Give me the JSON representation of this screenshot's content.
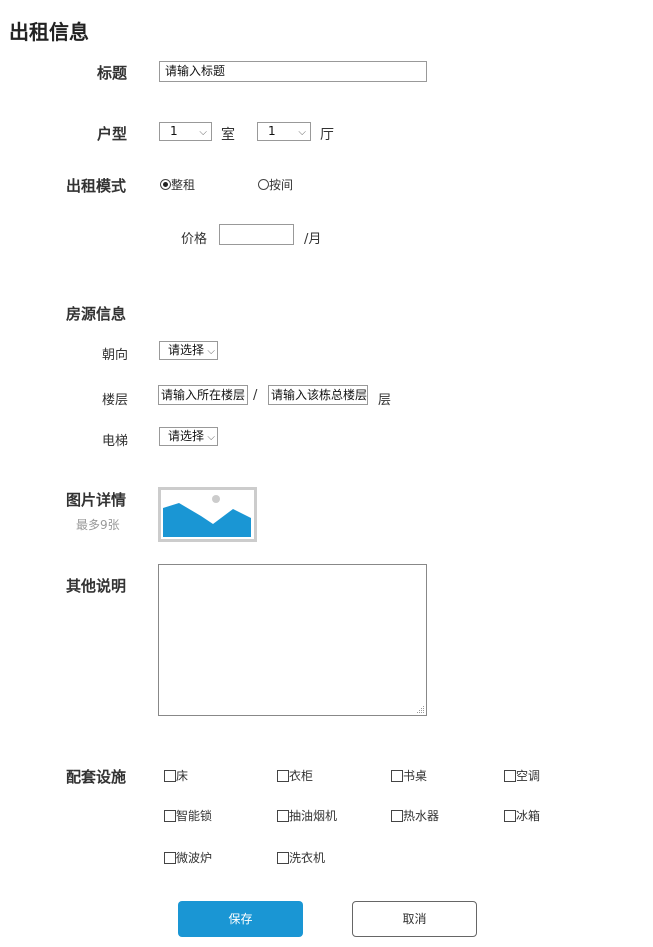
{
  "page_title": "出租信息",
  "title_field": {
    "label": "标题",
    "placeholder": "请输入标题"
  },
  "layout_field": {
    "label": "户型",
    "rooms_value": "1",
    "rooms_unit": "室",
    "halls_value": "1",
    "halls_unit": "厅"
  },
  "rent_mode": {
    "label": "出租模式",
    "options": [
      "整租",
      "按间"
    ],
    "selected": "整租"
  },
  "price": {
    "label": "价格",
    "value": "",
    "unit": "/月"
  },
  "house_info": {
    "section_label": "房源信息",
    "orientation": {
      "label": "朝向",
      "value": "请选择"
    },
    "floor": {
      "label": "楼层",
      "floor_placeholder": "请输入所在楼层",
      "separator": "/",
      "total_placeholder": "请输入该栋总楼层",
      "unit": "层"
    },
    "elevator": {
      "label": "电梯",
      "value": "请选择"
    }
  },
  "images": {
    "label": "图片详情",
    "hint": "最多9张",
    "icon": "image-placeholder-icon"
  },
  "notes": {
    "label": "其他说明",
    "value": ""
  },
  "facilities": {
    "label": "配套设施",
    "items": [
      "床",
      "衣柜",
      "书桌",
      "空调",
      "智能锁",
      "抽油烟机",
      "热水器",
      "冰箱",
      "微波炉",
      "洗衣机"
    ]
  },
  "actions": {
    "save": "保存",
    "cancel": "取消"
  },
  "colors": {
    "primary": "#1a96d4",
    "image_blue": "#1a96d4",
    "border": "#999999"
  }
}
